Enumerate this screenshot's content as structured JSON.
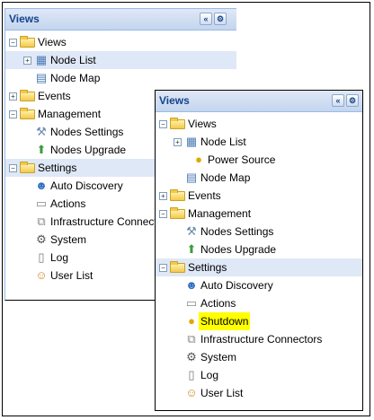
{
  "back_panel": {
    "title": "Views",
    "collapse_btn": "«",
    "settings_btn": "⚙",
    "items": [
      {
        "label": "Views"
      },
      {
        "label": "Node List"
      },
      {
        "label": "Node Map"
      },
      {
        "label": "Events"
      },
      {
        "label": "Management"
      },
      {
        "label": "Nodes Settings"
      },
      {
        "label": "Nodes Upgrade"
      },
      {
        "label": "Settings"
      },
      {
        "label": "Auto Discovery"
      },
      {
        "label": "Actions"
      },
      {
        "label": "Infrastructure Connectors"
      },
      {
        "label": "System"
      },
      {
        "label": "Log"
      },
      {
        "label": "User List"
      }
    ]
  },
  "front_panel": {
    "title": "Views",
    "collapse_btn": "«",
    "settings_btn": "⚙",
    "items": [
      {
        "label": "Views"
      },
      {
        "label": "Node List"
      },
      {
        "label": "Power Source"
      },
      {
        "label": "Node Map"
      },
      {
        "label": "Events"
      },
      {
        "label": "Management"
      },
      {
        "label": "Nodes Settings"
      },
      {
        "label": "Nodes Upgrade"
      },
      {
        "label": "Settings"
      },
      {
        "label": "Auto Discovery"
      },
      {
        "label": "Actions"
      },
      {
        "label": "Shutdown"
      },
      {
        "label": "Infrastructure Connectors"
      },
      {
        "label": "System"
      },
      {
        "label": "Log"
      },
      {
        "label": "User List"
      }
    ]
  },
  "colors": {
    "title_text": "#15428b",
    "highlight_row": "#dfe8f6",
    "shutdown_highlight": "#ffff00"
  }
}
